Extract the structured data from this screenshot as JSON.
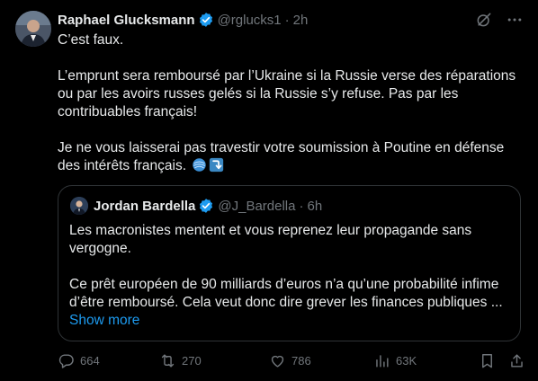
{
  "tweet": {
    "author_name": "Raphael Glucksmann",
    "author_handle": "@rglucks1",
    "separator": "·",
    "time": "2h",
    "paragraphs": [
      "C’est faux.",
      "L’emprunt sera remboursé par l’Ukraine si la Russie verse des réparations ou par les avoirs russes gelés si la Russie s’y refuse. Pas par les contribuables français!",
      "Je ne vous laisserai pas travestir votre soumission à Poutine en défense des intérêts français."
    ]
  },
  "quoted": {
    "author_name": "Jordan Bardella",
    "author_handle": "@J_Bardella",
    "separator": "·",
    "time": "6h",
    "paragraphs": [
      "Les macronistes mentent et vous reprenez leur propagande sans vergogne.",
      "Ce prêt européen de 90 milliards d’euros n’a qu’une probabilité infime d’être remboursé. Cela veut donc dire grever les finances publiques ..."
    ],
    "show_more_label": "Show more"
  },
  "actions": {
    "replies": "664",
    "reposts": "270",
    "likes": "786",
    "views": "63K"
  },
  "colors": {
    "background": "#000000",
    "text": "#e7e9ea",
    "muted": "#71767b",
    "accent": "#1d9bf0",
    "border": "#2f3336"
  },
  "icons": {
    "verified": "verified-badge-icon",
    "grok": "grok-icon",
    "more": "more-icon",
    "emoji_1": "yarn-ball-emoji",
    "emoji_2": "right-arrow-curving-down-emoji",
    "reply": "reply-icon",
    "repost": "repost-icon",
    "like": "like-icon",
    "views": "views-icon",
    "bookmark": "bookmark-icon",
    "share": "share-icon"
  }
}
